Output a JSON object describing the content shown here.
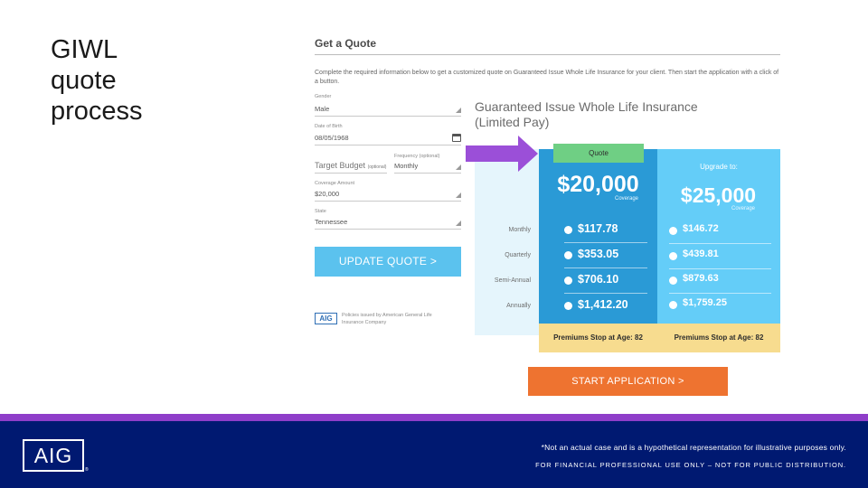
{
  "slide": {
    "title": "GIWL\nquote\nprocess"
  },
  "form": {
    "heading": "Get a Quote",
    "intro": "Complete the required information below to get a customized quote on Guaranteed Issue Whole Life Insurance for your client. Then start the application with a click of a button.",
    "gender": {
      "label": "Gender",
      "value": "Male"
    },
    "dob": {
      "label": "Date of Birth",
      "value": "08/05/1968"
    },
    "target_budget": {
      "value": "Target Budget",
      "optional": "(optional)"
    },
    "frequency": {
      "label": "Frequency (optional)",
      "value": "Monthly"
    },
    "coverage_amount": {
      "label": "Coverage Amount",
      "value": "$20,000"
    },
    "state": {
      "label": "State",
      "value": "Tennessee"
    },
    "update_button": "UPDATE QUOTE >",
    "aig_logo": "AIG",
    "policy_note": "Policies issued by American General Life Insurance Company"
  },
  "product": {
    "title": "Guaranteed Issue Whole Life Insurance\n(Limited Pay)",
    "quote_tab": "Quote",
    "quote_coverage": "$20,000",
    "coverage_label": "Coverage",
    "upgrade_label": "Upgrade to:",
    "upgrade_coverage": "$25,000",
    "frequencies": [
      "Monthly",
      "Quarterly",
      "Semi-Annual",
      "Annually"
    ],
    "quote_premiums": [
      "$117.78",
      "$353.05",
      "$706.10",
      "$1,412.20"
    ],
    "upgrade_premiums": [
      "$146.72",
      "$439.81",
      "$879.63",
      "$1,759.25"
    ],
    "premiums_stop_quote": "Premiums Stop at Age: 82",
    "premiums_stop_upgrade": "Premiums Stop at Age: 82",
    "start_button": "START APPLICATION >"
  },
  "footer": {
    "logo": "AIG",
    "registered": "®",
    "disclaimer": "*Not an actual case and is a hypothetical representation for illustrative purposes only.",
    "distribution": "FOR FINANCIAL PROFESSIONAL USE ONLY – NOT FOR PUBLIC DISTRIBUTION."
  },
  "colors": {
    "quote_column": "#2a9ad6",
    "upgrade_column": "#64cdf8",
    "quote_tab": "#6fcf84",
    "start_button": "#ee7330",
    "arrow": "#9b4fd8",
    "footer_band": "#001971",
    "footer_stripe": "#8f3ec9"
  }
}
